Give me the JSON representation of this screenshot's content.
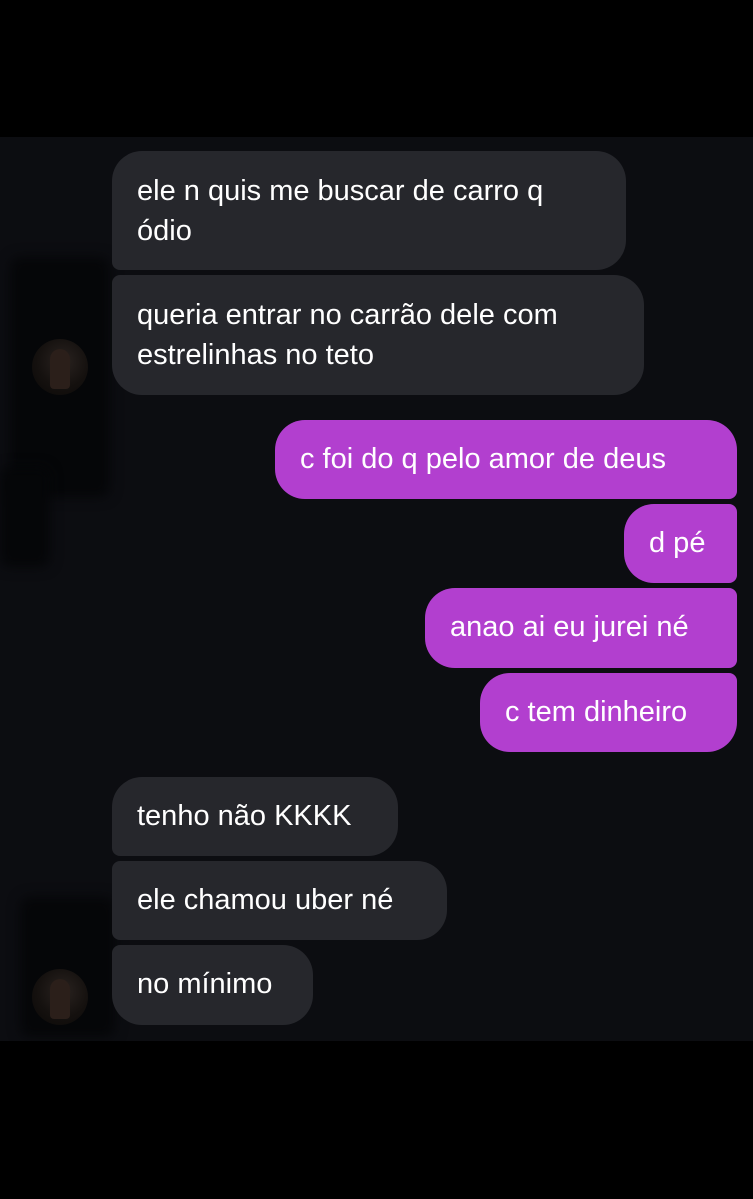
{
  "conversation": {
    "group1": [
      "ele n quis me buscar de carro q\nódio",
      "queria entrar no carrão dele com\nestrelinhas no teto"
    ],
    "sent": [
      "c foi do q pelo amor de deus",
      "d pé",
      "anao ai eu jurei né",
      "c tem dinheiro"
    ],
    "group2": [
      "tenho não KKKK",
      "ele chamou uber né",
      "no mínimo"
    ]
  },
  "colors": {
    "sent_bubble": "#b23fcf",
    "received_bubble": "#26272c",
    "background": "#0c0d11"
  },
  "icons": {
    "contact_avatar": "avatar-photo"
  }
}
